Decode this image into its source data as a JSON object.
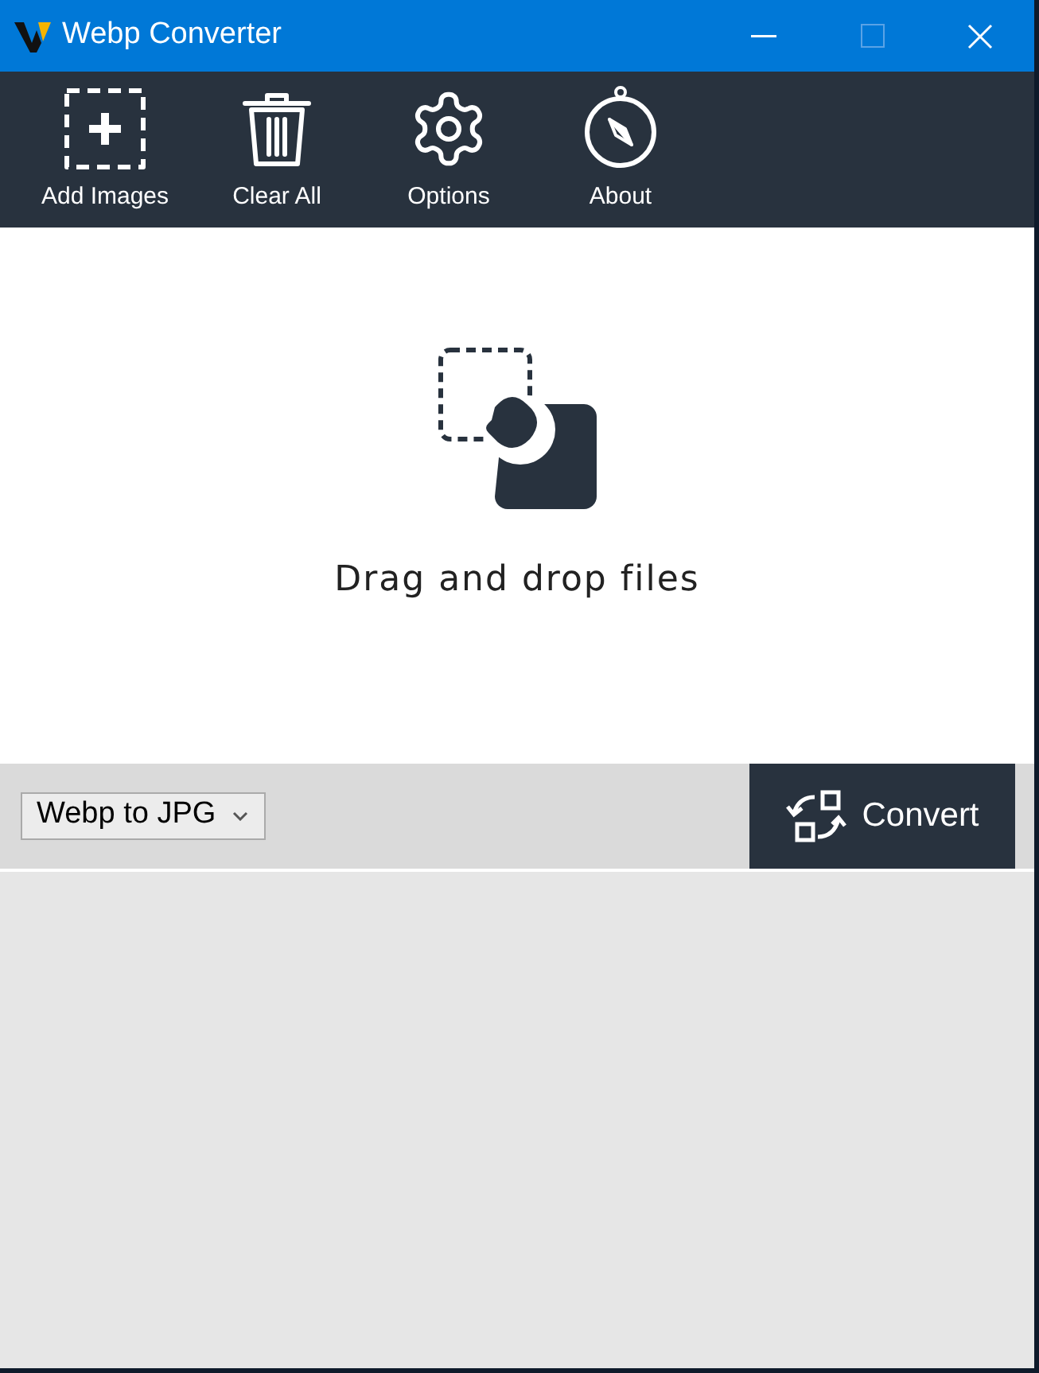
{
  "window": {
    "title": "Webp Converter"
  },
  "toolbar": [
    {
      "kind": "add",
      "label": "Add Images"
    },
    {
      "kind": "clear",
      "label": "Clear All"
    },
    {
      "kind": "options",
      "label": "Options"
    },
    {
      "kind": "about",
      "label": "About"
    }
  ],
  "drop_area": {
    "text": "Drag and drop files"
  },
  "format_select": {
    "value": "Webp to JPG"
  },
  "convert_button": {
    "label": "Convert"
  }
}
